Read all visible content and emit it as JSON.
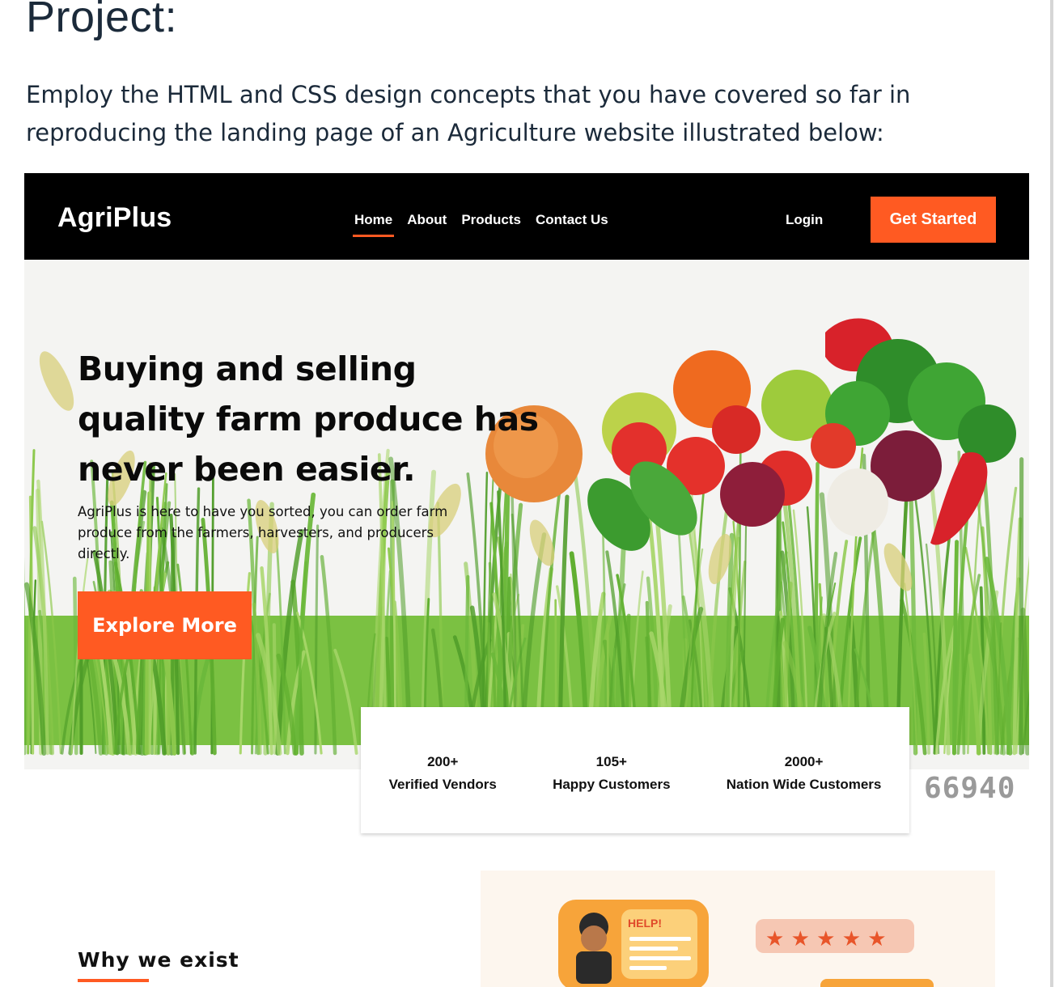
{
  "document": {
    "title": "Project:",
    "intro": "Employ the HTML and CSS design concepts that you have covered so far in reproducing the landing page of an Agriculture website illustrated below:"
  },
  "navbar": {
    "brand": "AgriPlus",
    "links": [
      {
        "label": "Home",
        "active": true
      },
      {
        "label": "About"
      },
      {
        "label": "Products"
      },
      {
        "label": "Contact Us"
      }
    ],
    "login": "Login",
    "cta": "Get Started"
  },
  "hero": {
    "headline": "Buying and selling quality farm produce has never been easier.",
    "subtext": "AgriPlus is here to have you sorted, you can order farm produce from the farmers, harvesters,  and producers directly.",
    "button": "Explore More"
  },
  "stats": [
    {
      "value": "200+",
      "label": "Verified Vendors"
    },
    {
      "value": "105+",
      "label": "Happy Customers"
    },
    {
      "value": "2000+",
      "label": "Nation Wide Customers"
    }
  ],
  "side_number": "66940",
  "why_section": {
    "title": "Why we exist",
    "help_label": "HELP!"
  },
  "colors": {
    "accent": "#ff5a22",
    "navbar_bg": "#000000",
    "text_dark": "#1b2a3a"
  }
}
